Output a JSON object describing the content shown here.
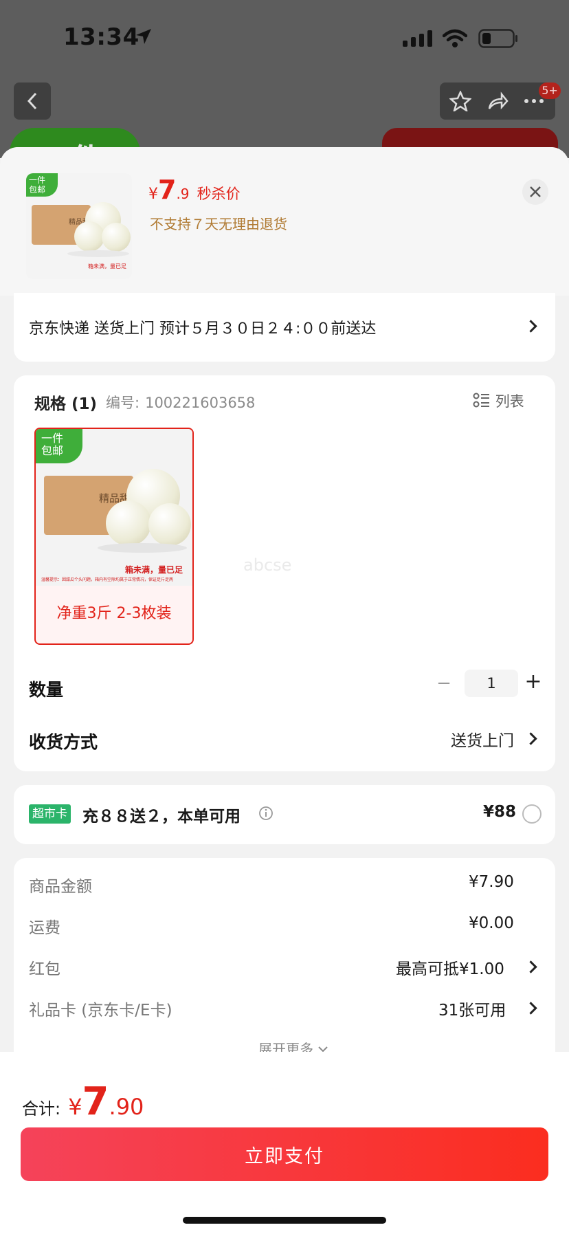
{
  "status_bar": {
    "time": "13:34"
  },
  "nav": {
    "badge": "5+"
  },
  "background_fragment": {
    "text": "一件"
  },
  "product": {
    "price_symbol": "¥",
    "price_int": "7",
    "price_dec": ".9",
    "price_tag": "秒杀价",
    "return_policy": "不支持７天无理由退货",
    "image_badge_line1": "一件",
    "image_badge_line2": "包邮",
    "image_title": "精品甜瓜",
    "image_caption": "箱未满，量已足",
    "image_notice": "温馨提示：因甜瓜个头问题，箱内有空隙均属于正常情况，保证足斤足两"
  },
  "delivery": {
    "text": "京东快递 送货上门 预计５月３０日２４:００前送达"
  },
  "spec": {
    "title": "规格 (1)",
    "id_label": "编号:",
    "id_value": "100221603658",
    "list_label": "列表",
    "option_label": "净重3斤 2-3枚装"
  },
  "watermark": "abcse",
  "quantity": {
    "label": "数量",
    "value": "1",
    "minus": "−",
    "plus": "+"
  },
  "receive": {
    "label": "收货方式",
    "value": "送货上门"
  },
  "supermarket": {
    "badge": "超市卡",
    "text": "充８８送２，本单可用",
    "price": "¥88"
  },
  "summary": {
    "rows": [
      {
        "label": "商品金额",
        "value": "¥7.90"
      },
      {
        "label": "运费",
        "value": "¥0.00"
      },
      {
        "label": "红包",
        "value": "最高可抵¥1.00"
      },
      {
        "label": "礼品卡 (京东卡/E卡)",
        "value": "31张可用"
      }
    ],
    "expand": "展开更多"
  },
  "total": {
    "label": "合计:",
    "symbol": "¥",
    "int": "7",
    "dec": ".90"
  },
  "pay_button": "立即支付",
  "colors": {
    "accent_red": "#e2231a",
    "badge_green": "#2bb46a",
    "pay_gradient_start": "#f5435a",
    "pay_gradient_end": "#fb2d1f"
  }
}
